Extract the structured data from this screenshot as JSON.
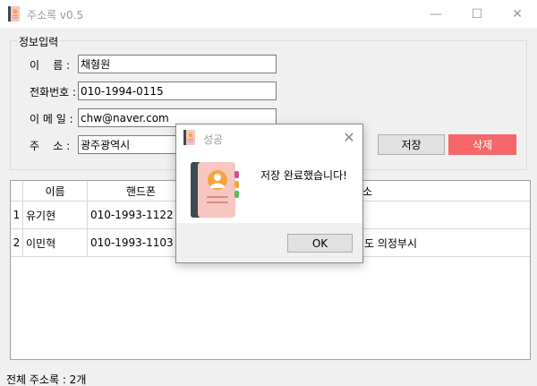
{
  "window": {
    "title": "주소록 v0.5",
    "controls": {
      "minimize": "—",
      "maximize": "☐",
      "close": "✕"
    }
  },
  "form": {
    "legend": "정보입력",
    "name_label": "이    름 :",
    "phone_label": "전화번호 :",
    "email_label": "이 메 일 :",
    "address_label": "주    소 :",
    "name_value": "채형원",
    "phone_value": "010-1994-0115",
    "email_value": "chw@naver.com",
    "address_value": "광주광역시",
    "save_label": "저장",
    "delete_label": "삭제"
  },
  "table": {
    "columns": [
      "이름",
      "핸드폰",
      "주소"
    ],
    "rows": [
      {
        "num": "1",
        "name": "유기현",
        "phone": "010-1993-1122",
        "address": ""
      },
      {
        "num": "2",
        "name": "이민혁",
        "phone": "010-1993-1103",
        "address": "도 의정부시"
      }
    ]
  },
  "status": {
    "text": "전체 주소록 : 2개"
  },
  "dialog": {
    "title": "성공",
    "message": "저장 완료했습니다!",
    "ok_label": "OK",
    "close": "✕"
  },
  "colors": {
    "delete_button": "#f56768",
    "icon_pink": "#f6c7c0",
    "icon_dark": "#3c4a54"
  },
  "icons": {
    "app": "address-book-icon",
    "dialog": "address-book-icon"
  }
}
